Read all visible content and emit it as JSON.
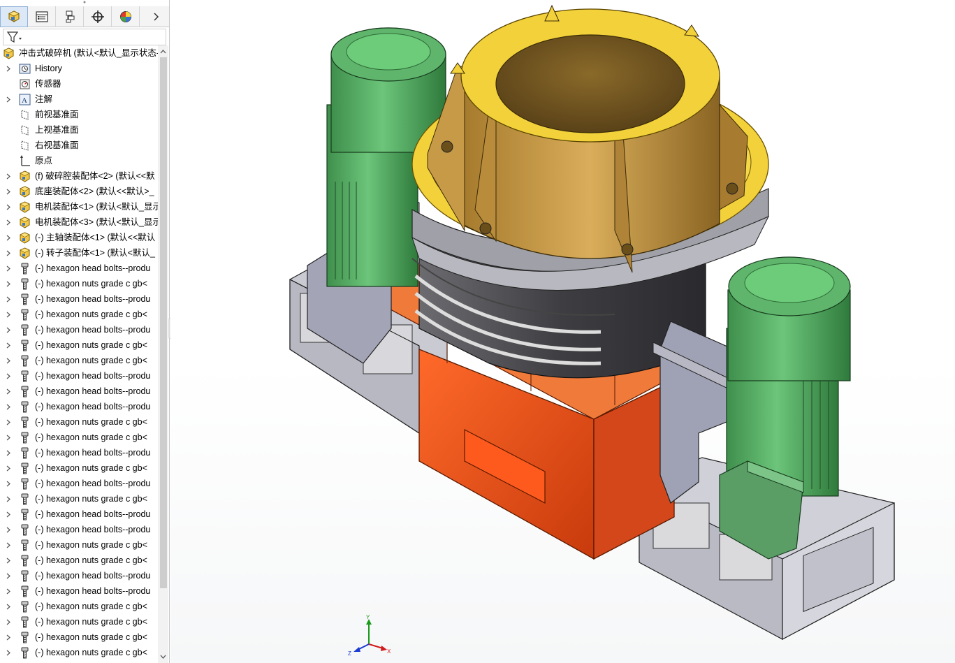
{
  "app": {
    "name": "SolidWorks"
  },
  "feature_tree": {
    "tabs": [
      "FeatureManager",
      "PropertyManager",
      "ConfigurationManager",
      "DimXpertManager",
      "DisplayManager"
    ],
    "root_label": "冲击式破碎机  (默认<默认_显示状态-",
    "items": [
      {
        "label": "History",
        "icon": "history-icon",
        "expandable": true
      },
      {
        "label": "传感器",
        "icon": "sensor-icon",
        "expandable": false
      },
      {
        "label": "注解",
        "icon": "annotation-icon",
        "expandable": true
      },
      {
        "label": "前视基准面",
        "icon": "plane-icon",
        "expandable": false
      },
      {
        "label": "上视基准面",
        "icon": "plane-icon",
        "expandable": false
      },
      {
        "label": "右视基准面",
        "icon": "plane-icon",
        "expandable": false
      },
      {
        "label": "原点",
        "icon": "origin-icon",
        "expandable": false
      },
      {
        "label": "(f) 破碎腔装配体<2>  (默认<<默",
        "icon": "assembly-icon",
        "expandable": true
      },
      {
        "label": "底座装配体<2>  (默认<<默认>_",
        "icon": "assembly-icon",
        "expandable": true
      },
      {
        "label": "电机装配体<1>  (默认<默认_显示",
        "icon": "assembly-icon",
        "expandable": true
      },
      {
        "label": "电机装配体<3>  (默认<默认_显示",
        "icon": "assembly-icon",
        "expandable": true
      },
      {
        "label": "(-) 主轴装配体<1>  (默认<<默认",
        "icon": "assembly-icon",
        "expandable": true
      },
      {
        "label": "(-) 转子装配体<1>  (默认<默认_",
        "icon": "assembly-icon",
        "expandable": true
      },
      {
        "label": "(-) hexagon head bolts--produ",
        "icon": "bolt-icon",
        "expandable": true
      },
      {
        "label": "(-) hexagon nuts grade c gb<",
        "icon": "bolt-icon",
        "expandable": true
      },
      {
        "label": "(-) hexagon head bolts--produ",
        "icon": "bolt-icon",
        "expandable": true
      },
      {
        "label": "(-) hexagon nuts grade c gb<",
        "icon": "bolt-icon",
        "expandable": true
      },
      {
        "label": "(-) hexagon head bolts--produ",
        "icon": "bolt-icon",
        "expandable": true
      },
      {
        "label": "(-) hexagon nuts grade c gb<",
        "icon": "bolt-icon",
        "expandable": true
      },
      {
        "label": "(-) hexagon nuts grade c gb<",
        "icon": "bolt-icon",
        "expandable": true
      },
      {
        "label": "(-) hexagon head bolts--produ",
        "icon": "bolt-icon",
        "expandable": true
      },
      {
        "label": "(-) hexagon head bolts--produ",
        "icon": "bolt-icon",
        "expandable": true
      },
      {
        "label": "(-) hexagon head bolts--produ",
        "icon": "bolt-icon",
        "expandable": true
      },
      {
        "label": "(-) hexagon nuts grade c gb<",
        "icon": "bolt-icon",
        "expandable": true
      },
      {
        "label": "(-) hexagon nuts grade c gb<",
        "icon": "bolt-icon",
        "expandable": true
      },
      {
        "label": "(-) hexagon head bolts--produ",
        "icon": "bolt-icon",
        "expandable": true
      },
      {
        "label": "(-) hexagon nuts grade c gb<",
        "icon": "bolt-icon",
        "expandable": true
      },
      {
        "label": "(-) hexagon head bolts--produ",
        "icon": "bolt-icon",
        "expandable": true
      },
      {
        "label": "(-) hexagon nuts grade c gb<",
        "icon": "bolt-icon",
        "expandable": true
      },
      {
        "label": "(-) hexagon head bolts--produ",
        "icon": "bolt-icon",
        "expandable": true
      },
      {
        "label": "(-) hexagon head bolts--produ",
        "icon": "bolt-icon",
        "expandable": true
      },
      {
        "label": "(-) hexagon nuts grade c gb<",
        "icon": "bolt-icon",
        "expandable": true
      },
      {
        "label": "(-) hexagon nuts grade c gb<",
        "icon": "bolt-icon",
        "expandable": true
      },
      {
        "label": "(-) hexagon head bolts--produ",
        "icon": "bolt-icon",
        "expandable": true
      },
      {
        "label": "(-) hexagon head bolts--produ",
        "icon": "bolt-icon",
        "expandable": true
      },
      {
        "label": "(-) hexagon nuts grade c gb<",
        "icon": "bolt-icon",
        "expandable": true
      },
      {
        "label": "(-) hexagon nuts grade c gb<",
        "icon": "bolt-icon",
        "expandable": true
      },
      {
        "label": "(-) hexagon nuts grade c gb<",
        "icon": "bolt-icon",
        "expandable": true
      },
      {
        "label": "(-) hexagon nuts grade c gb<",
        "icon": "bolt-icon",
        "expandable": true
      }
    ]
  },
  "viewport": {
    "triad": {
      "x": "X",
      "y": "Y",
      "z": "Z"
    }
  },
  "colors": {
    "motor_green": "#5fae6a",
    "housing_yellow": "#f2d13a",
    "bronze": "#c89a45",
    "chamber_dark": "#4a4a4e",
    "hopper_orange": "#e8551c",
    "frame_gray": "#a4a6b8",
    "base_silver": "#cfd0d8"
  }
}
